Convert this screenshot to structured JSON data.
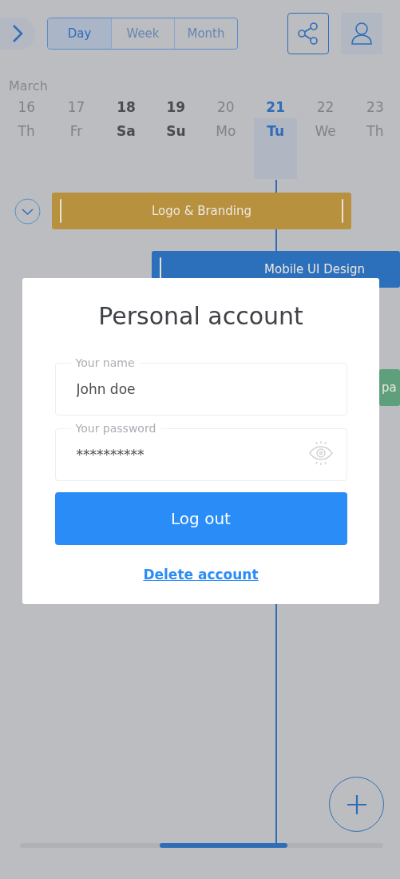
{
  "header": {
    "view_tabs": [
      {
        "label": "Day",
        "selected": true
      },
      {
        "label": "Week",
        "selected": false
      },
      {
        "label": "Month",
        "selected": false
      }
    ]
  },
  "month": "March",
  "days": [
    {
      "date": "16",
      "weekday": "Th",
      "selected": false,
      "weekend": false
    },
    {
      "date": "17",
      "weekday": "Fr",
      "selected": false,
      "weekend": false
    },
    {
      "date": "18",
      "weekday": "Sa",
      "selected": false,
      "weekend": true
    },
    {
      "date": "19",
      "weekday": "Su",
      "selected": false,
      "weekend": true
    },
    {
      "date": "20",
      "weekday": "Mo",
      "selected": false,
      "weekend": false
    },
    {
      "date": "21",
      "weekday": "Tu",
      "selected": true,
      "weekend": false
    },
    {
      "date": "22",
      "weekday": "We",
      "selected": false,
      "weekend": false
    },
    {
      "date": "23",
      "weekday": "Th",
      "selected": false,
      "weekend": false
    }
  ],
  "events": [
    {
      "title": "Logo & Branding",
      "color": "#b8913f",
      "collapsible": true
    },
    {
      "title": "Mobile UI Design",
      "color": "#2c6fbb",
      "collapsible": false
    },
    {
      "title": "pa",
      "color": "#5e9f7c",
      "collapsible": false
    }
  ],
  "modal": {
    "title": "Personal account",
    "fields": [
      {
        "label": "Your name",
        "value": "John doe",
        "kind": "text"
      },
      {
        "label": "Your password",
        "value": "**********",
        "kind": "password"
      }
    ],
    "primary_button": "Log out",
    "link": "Delete account"
  }
}
